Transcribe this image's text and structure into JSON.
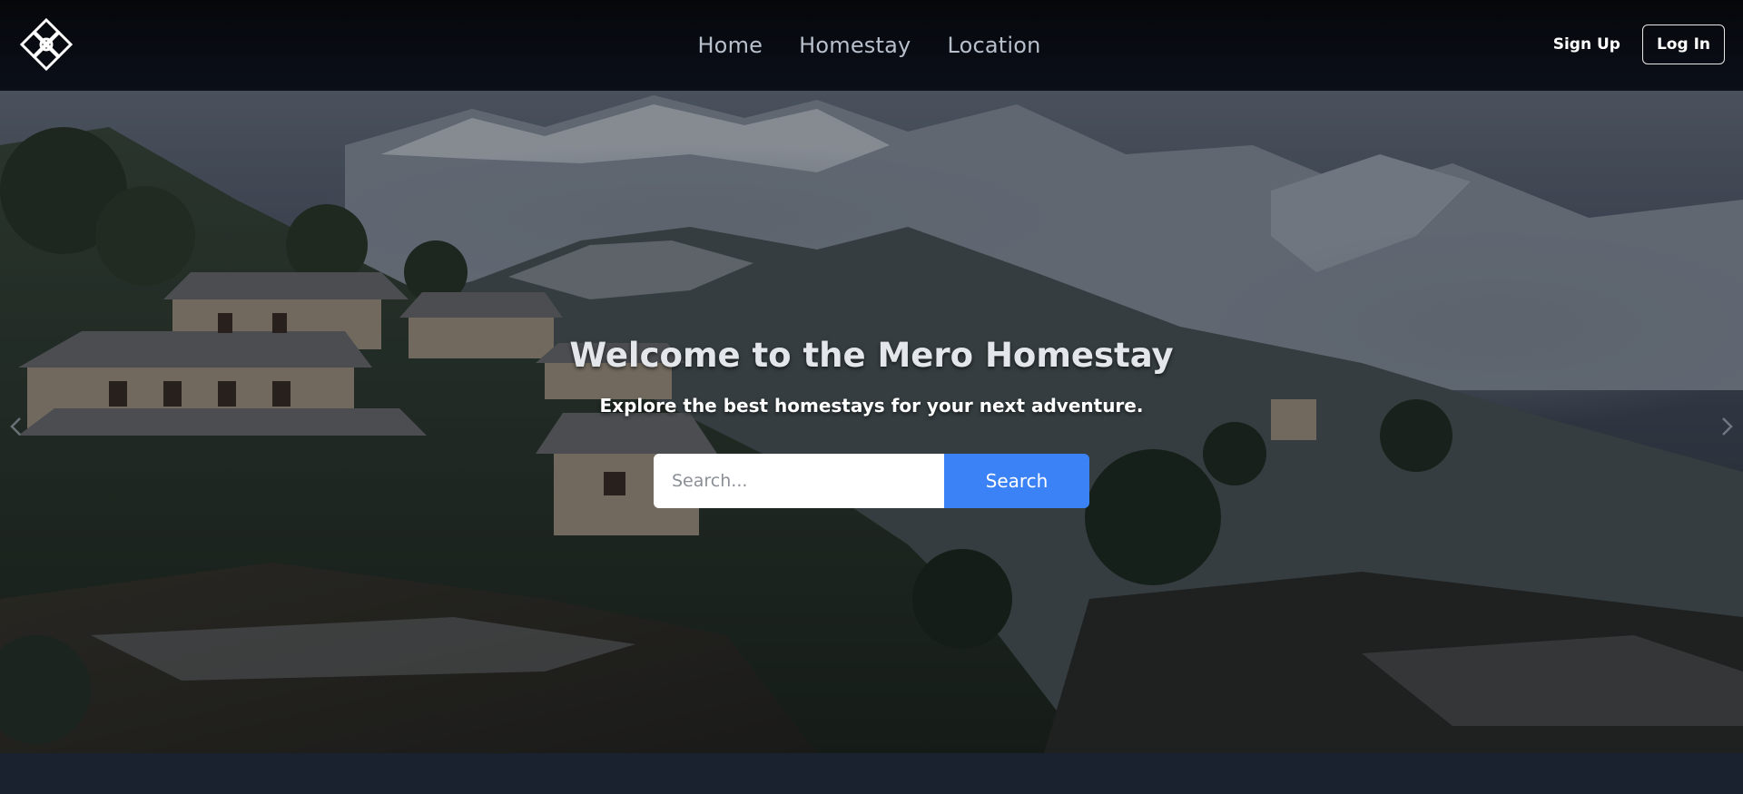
{
  "brand": {
    "logo_icon": "diamond-knot-logo-icon"
  },
  "nav": {
    "links": [
      {
        "label": "Home"
      },
      {
        "label": "Homestay"
      },
      {
        "label": "Location"
      }
    ],
    "signup_label": "Sign Up",
    "login_label": "Log In"
  },
  "hero": {
    "title": "Welcome to the Mero Homestay",
    "subtitle": "Explore the best homestays for your next adventure.",
    "search": {
      "placeholder": "Search...",
      "value": "",
      "button_label": "Search"
    },
    "prev_icon": "chevron-left-icon",
    "next_icon": "chevron-right-icon"
  },
  "colors": {
    "navbar_bg": "#070a10",
    "accent": "#3b82f6",
    "page_bg": "#18202d"
  }
}
